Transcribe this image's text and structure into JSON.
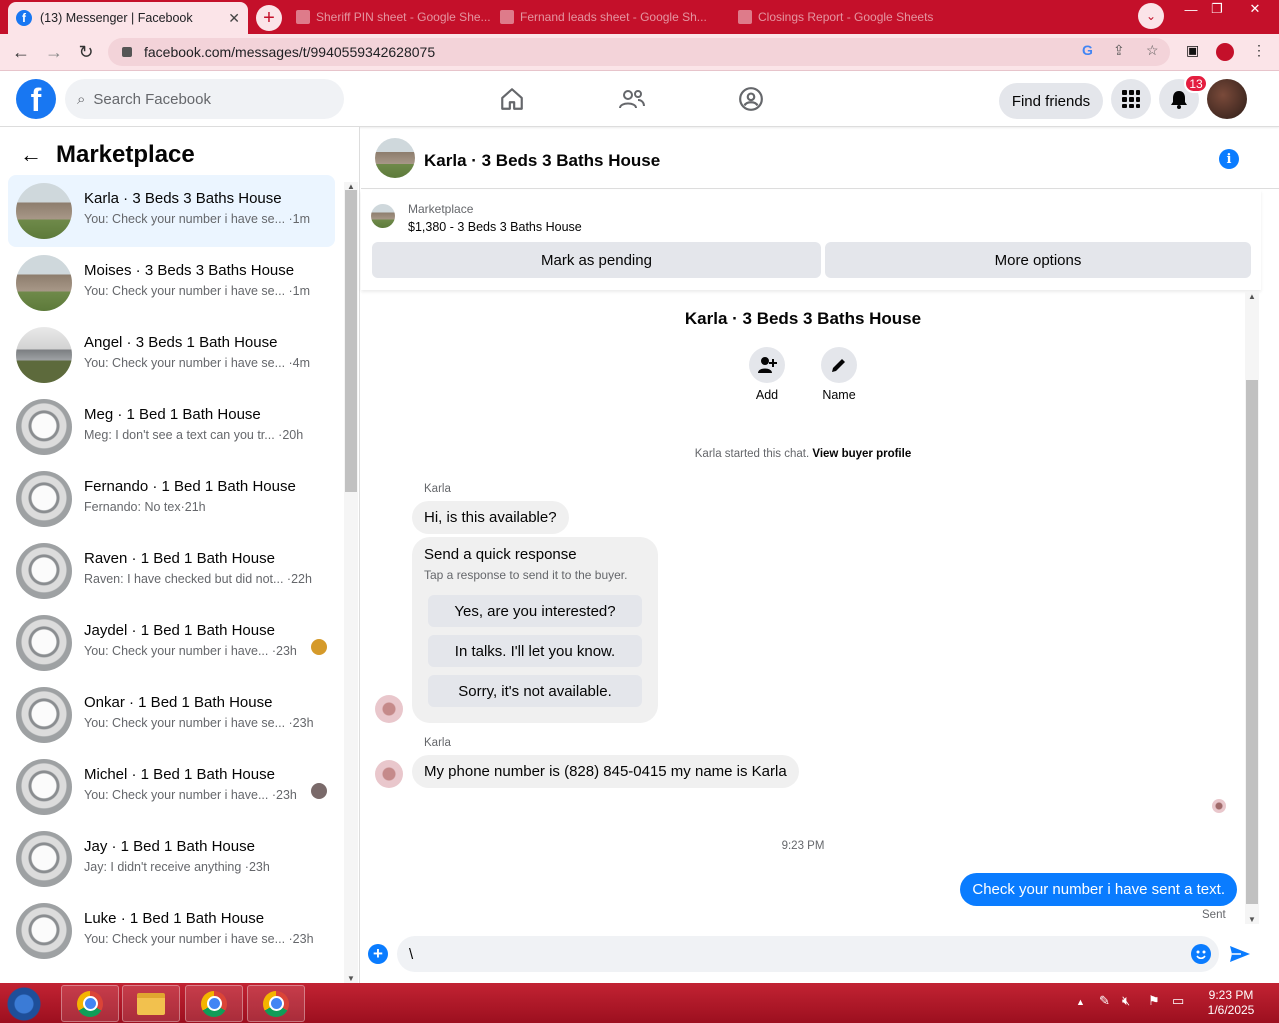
{
  "browser": {
    "active_tab_title": "(13) Messenger | Facebook",
    "other_tabs": [
      "Sheriff PIN sheet - Google She...",
      "Fernand leads sheet - Google Sh...",
      "Closings Report - Google Sheets"
    ],
    "url": "facebook.com/messages/t/9940559342628075"
  },
  "fb_header": {
    "search_placeholder": "Search Facebook",
    "find_friends": "Find friends",
    "notifications_count": "13"
  },
  "sidebar": {
    "title": "Marketplace",
    "conversations": [
      {
        "name": "Karla · 3 Beds 3 Baths House",
        "snippet": "You: Check your number i have se... ·1m",
        "thumb": "house",
        "active": true
      },
      {
        "name": "Moises · 3 Beds 3 Baths House",
        "snippet": "You: Check your number i have se... ·1m",
        "thumb": "house"
      },
      {
        "name": "Angel · 3 Beds 1 Bath House",
        "snippet": "You: Check your number i have se... ·4m",
        "thumb": "gray"
      },
      {
        "name": "Meg · 1 Bed 1 Bath House",
        "snippet": "Meg: I don't see a text can you tr... ·20h",
        "thumb": "door"
      },
      {
        "name": "Fernando · 1 Bed 1 Bath House",
        "snippet": "Fernando: No tex·21h",
        "thumb": "door"
      },
      {
        "name": "Raven · 1 Bed 1 Bath House",
        "snippet": "Raven: I have checked but did not... ·22h",
        "thumb": "door"
      },
      {
        "name": "Jaydel · 1 Bed 1 Bath House",
        "snippet": "You: Check your number i have... ·23h",
        "thumb": "door"
      },
      {
        "name": "Onkar · 1 Bed 1 Bath House",
        "snippet": "You: Check your number i have se... ·23h",
        "thumb": "door"
      },
      {
        "name": "Michel · 1 Bed 1 Bath House",
        "snippet": "You: Check your number i have... ·23h",
        "thumb": "door"
      },
      {
        "name": "Jay · 1 Bed 1 Bath House",
        "snippet": "Jay: I didn't receive anything ·23h",
        "thumb": "door"
      },
      {
        "name": "Luke · 1 Bed 1 Bath House",
        "snippet": "You: Check your number i have se... ·23h",
        "thumb": "door"
      }
    ]
  },
  "conversation": {
    "title": "Karla · 3 Beds 3 Baths House",
    "marketplace_label": "Marketplace",
    "listing": "$1,380 - 3 Beds 3 Baths House",
    "mark_pending": "Mark as pending",
    "more_options": "More options",
    "intro_name": "Karla · 3 Beds 3 Baths House",
    "add_label": "Add",
    "name_label": "Name",
    "started_text": "Karla started this chat.",
    "view_profile": "View buyer profile",
    "sender1": "Karla",
    "msg1": "Hi, is this available?",
    "quick_title": "Send a quick response",
    "quick_sub": "Tap a response to send it to the buyer.",
    "quick_options": [
      "Yes, are you interested?",
      "In talks. I'll let you know.",
      "Sorry, it's not available."
    ],
    "sender2": "Karla",
    "msg2": "My phone number is (828) 845-0415 my name is Karla",
    "time_sep": "9:23 PM",
    "my_msg": "Check your number i have sent a text.",
    "sent_status": "Sent",
    "composer_value": "\\"
  },
  "taskbar": {
    "time": "9:23 PM",
    "date": "1/6/2025"
  }
}
